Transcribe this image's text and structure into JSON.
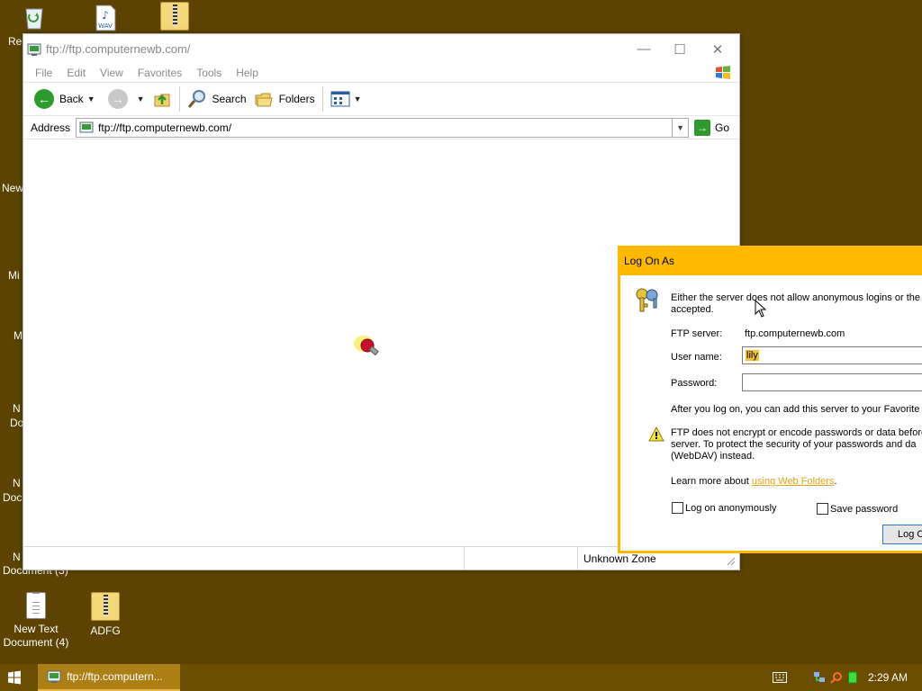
{
  "desktop": {
    "icons": [
      {
        "label": "Rec",
        "icon": "recycle-bin-icon"
      },
      {
        "label": "",
        "icon": "wav-file-icon",
        "badge": "WAV"
      },
      {
        "label": "",
        "icon": "zip-folder-icon"
      },
      {
        "label": "New Text Document (4)",
        "icon": "text-document-icon"
      },
      {
        "label": "ADFG",
        "icon": "zip-folder-icon"
      }
    ],
    "partial_labels": [
      "New",
      "Mi",
      "M",
      "N",
      "Doc",
      "N",
      "Doc",
      "N",
      "Document (3)"
    ]
  },
  "window": {
    "title": "ftp://ftp.computernewb.com/",
    "controls": {
      "minimize": "—",
      "maximize": "☐",
      "close": "✕"
    },
    "menu": [
      "File",
      "Edit",
      "View",
      "Favorites",
      "Tools",
      "Help"
    ],
    "toolbar": {
      "back": "Back",
      "search": "Search",
      "folders": "Folders"
    },
    "address": {
      "label": "Address",
      "value": "ftp://ftp.computernewb.com/",
      "go": "Go"
    },
    "status": {
      "zone": "Unknown Zone"
    }
  },
  "dialog": {
    "title": "Log On As",
    "message": "Either the server does not allow anonymous logins or the e",
    "message_line2": "accepted.",
    "ftp_server_label": "FTP server:",
    "ftp_server_value": "ftp.computernewb.com",
    "username_label": "User name:",
    "username_value": "lily",
    "password_label": "Password:",
    "password_value": "",
    "after_logon": "After you log on, you can add this server to your Favorite",
    "warning_line1": "FTP does not encrypt or encode passwords or data before",
    "warning_line2": "server.  To protect the security of your passwords and da",
    "warning_line3": "(WebDAV) instead.",
    "learn_more": "Learn more about",
    "learn_more_link": "using Web Folders",
    "learn_more_end": ".",
    "anon_label": "Log on anonymously",
    "anon_checked": false,
    "save_label": "Save password",
    "save_checked": false,
    "logon_button": "Log O"
  },
  "taskbar": {
    "task_label": "ftp://ftp.computern...",
    "clock": "2:29 AM"
  },
  "colors": {
    "desktop": "#5c4302",
    "dialog_accent": "#ffb900",
    "taskbar": "#6b4d02",
    "active_task": "#ab7f14"
  }
}
